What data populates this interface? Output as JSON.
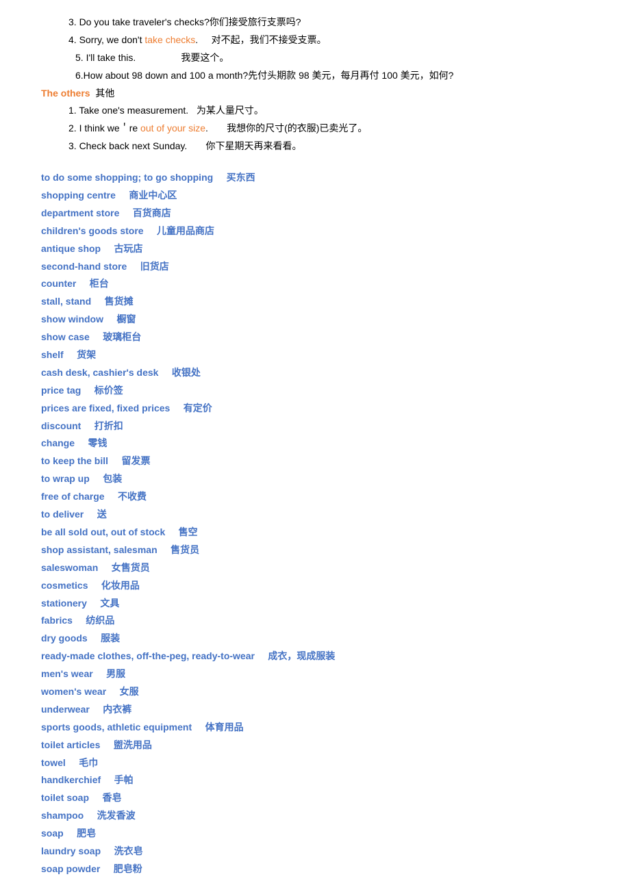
{
  "sentences": [
    {
      "num": "3.",
      "pre": "Do you take traveler's checks?",
      "post": "你们接受旅行支票吗?",
      "indent": "indent1"
    },
    {
      "num": "4.",
      "pre": "Sorry, we don't ",
      "hl": "take checks",
      "post": ".     对不起，我们不接受支票。",
      "indent": "indent1"
    },
    {
      "num": "5.",
      "pre": "I'll take this.                 我要这个。",
      "indent": "indent2"
    },
    {
      "num": "6.",
      "pre": "How about 98 down and 100 a month?先付头期款 98 美元，每月再付 100 美元，如何?",
      "indent": "indent2",
      "nospace": true
    }
  ],
  "sectionHeader": {
    "en": "The others",
    "zh": "  其他"
  },
  "others": [
    {
      "num": "1.",
      "pre": "Take one's measurement.   为某人量尺寸。"
    },
    {
      "num": "2.",
      "pre": "I think we＇re ",
      "hl": "out of your size",
      "post": ".       我想你的尺寸(的衣服)已卖光了。"
    },
    {
      "num": "3.",
      "pre": "Check back next Sunday.       你下星期天再来看看。"
    }
  ],
  "vocab": [
    {
      "en": "to do some shopping; to go shopping",
      "zh": "买东西"
    },
    {
      "en": "shopping centre",
      "zh": "商业中心区"
    },
    {
      "en": "department store",
      "zh": "百货商店"
    },
    {
      "en": "children's goods store",
      "zh": "儿童用品商店"
    },
    {
      "en": "antique shop",
      "zh": "古玩店"
    },
    {
      "en": "second-hand store",
      "zh": "旧货店"
    },
    {
      "en": "counter",
      "zh": "柜台"
    },
    {
      "en": "stall, stand",
      "zh": "售货摊"
    },
    {
      "en": "show window",
      "zh": "橱窗"
    },
    {
      "en": "show case",
      "zh": "玻璃柜台"
    },
    {
      "en": "shelf",
      "zh": "货架"
    },
    {
      "en": "cash desk, cashier's desk",
      "zh": "收银处"
    },
    {
      "en": "price tag",
      "zh": "标价签"
    },
    {
      "en": "prices are fixed, fixed prices",
      "zh": "有定价"
    },
    {
      "en": "discount",
      "zh": "打折扣"
    },
    {
      "en": "change",
      "zh": "零钱"
    },
    {
      "en": "to keep the bill",
      "zh": "留发票"
    },
    {
      "en": "to wrap up",
      "zh": "包装"
    },
    {
      "en": "free of charge",
      "zh": "不收费"
    },
    {
      "en": "to deliver",
      "zh": "送"
    },
    {
      "en": "be all sold out, out of stock",
      "zh": "售空"
    },
    {
      "en": "shop assistant, salesman",
      "zh": "售货员"
    },
    {
      "en": "saleswoman",
      "zh": "女售货员"
    },
    {
      "en": "cosmetics",
      "zh": "化妆用品"
    },
    {
      "en": "stationery",
      "zh": "文具"
    },
    {
      "en": "fabrics",
      "zh": "纺织品"
    },
    {
      "en": "dry goods",
      "zh": "服装"
    },
    {
      "en": "ready-made clothes, off-the-peg, ready-to-wear",
      "zh": "成衣，现成服装"
    },
    {
      "en": "men's wear",
      "zh": "男服"
    },
    {
      "en": "women's wear",
      "zh": "女服"
    },
    {
      "en": "underwear",
      "zh": "内衣裤"
    },
    {
      "en": "sports goods, athletic equipment",
      "zh": "体育用品"
    },
    {
      "en": "toilet articles",
      "zh": "盥洗用品"
    },
    {
      "en": "towel",
      "zh": "毛巾"
    },
    {
      "en": "handkerchief",
      "zh": "手帕"
    },
    {
      "en": "toilet soap",
      "zh": "香皂"
    },
    {
      "en": "shampoo",
      "zh": "洗发香波"
    },
    {
      "en": "soap",
      "zh": "肥皂"
    },
    {
      "en": "laundry soap",
      "zh": "洗衣皂"
    },
    {
      "en": "soap powder",
      "zh": "肥皂粉"
    }
  ]
}
